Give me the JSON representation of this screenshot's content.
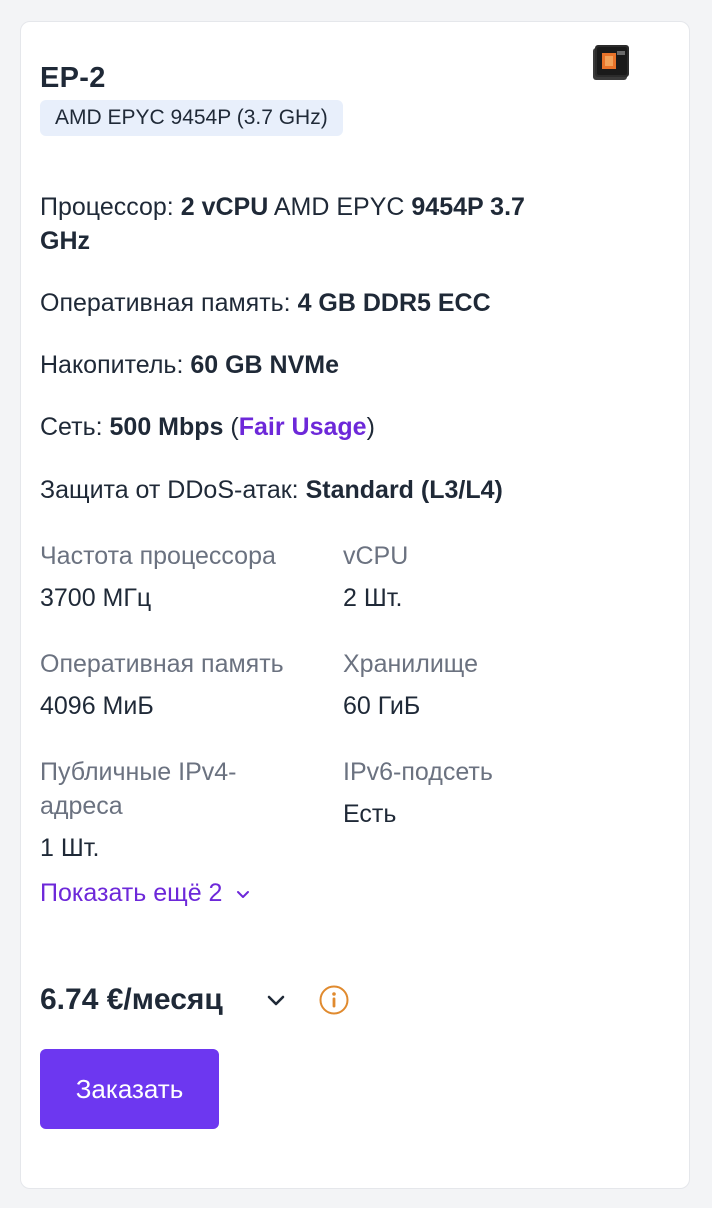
{
  "plan": {
    "title": "EP-2",
    "cpu_badge": "AMD EPYC 9454P (3.7 GHz)",
    "icon": "cpu-chip-icon"
  },
  "specs": {
    "processor": {
      "label": "Процессор:",
      "vcpu": "2 vCPU",
      "brand": "AMD EPYC",
      "model": "9454P 3.7",
      "freq": "GHz"
    },
    "ram": {
      "label": "Оперативная память:",
      "value": "4 GB DDR5 ECC"
    },
    "storage": {
      "label": "Накопитель:",
      "value": "60 GB NVMe"
    },
    "network": {
      "label": "Сеть:",
      "value": "500 Mbps",
      "open_paren": "(",
      "link": "Fair Usage",
      "close_paren": ")"
    },
    "ddos": {
      "label": "Защита от DDoS-атак:",
      "value": "Standard (L3/L4)"
    }
  },
  "params": [
    {
      "label": "Частота процессора",
      "value": "3700 МГц"
    },
    {
      "label": "vCPU",
      "value": "2 Шт."
    },
    {
      "label": "Оперативная память",
      "value": "4096 МиБ"
    },
    {
      "label": "Хранилище",
      "value": "60 ГиБ"
    },
    {
      "label": "Публичные IPv4-\nадреса",
      "value": "1 Шт."
    },
    {
      "label": "IPv6-подсеть",
      "value": "Есть"
    }
  ],
  "show_more": "Показать ещё 2",
  "price": "6.74 €/месяц",
  "order_button": "Заказать",
  "colors": {
    "accent": "#6d37f0",
    "link": "#6d28d9",
    "badge_bg": "#e8effb",
    "info_icon": "#e08a2e"
  }
}
